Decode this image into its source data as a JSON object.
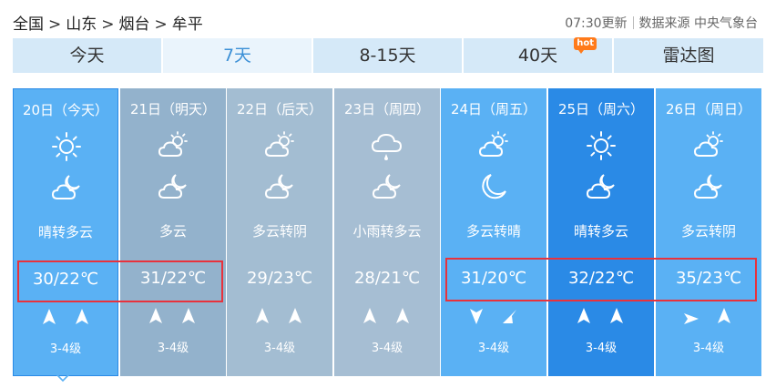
{
  "breadcrumb": [
    "全国",
    "山东",
    "烟台",
    "牟平"
  ],
  "breadcrumb_sep": ">",
  "update_time": "07:30更新",
  "data_source": "数据来源 中央气象台",
  "tabs": [
    {
      "label": "今天"
    },
    {
      "label": "7天",
      "active": true
    },
    {
      "label": "8-15天"
    },
    {
      "label": "40天",
      "badge": "hot"
    },
    {
      "label": "雷达图"
    }
  ],
  "days": [
    {
      "date": "20日（今天）",
      "icon_day": "sunny-icon",
      "icon_night": "cloudy-night-icon",
      "desc": "晴转多云",
      "temp": "30/22℃",
      "wind_dir": [
        "north-wind-icon",
        "north-wind-icon"
      ],
      "level": "3-4级",
      "bg": "#5ab1f4",
      "selected": true
    },
    {
      "date": "21日（明天）",
      "icon_day": "partly-cloudy-icon",
      "icon_night": "cloudy-night-icon",
      "desc": "多云",
      "temp": "31/22℃",
      "wind_dir": [
        "north-wind-icon",
        "north-wind-icon"
      ],
      "level": "3-4级",
      "bg": "#93b2cc"
    },
    {
      "date": "22日（后天）",
      "icon_day": "partly-cloudy-icon",
      "icon_night": "cloudy-night-icon",
      "desc": "多云转阴",
      "temp": "29/23℃",
      "wind_dir": [
        "north-wind-icon",
        "north-wind-icon"
      ],
      "level": "3-4级",
      "bg": "#a3bdd2"
    },
    {
      "date": "23日（周四）",
      "icon_day": "light-rain-icon",
      "icon_night": "cloudy-night-icon",
      "desc": "小雨转多云",
      "temp": "28/21℃",
      "wind_dir": [
        "north-wind-icon",
        "north-wind-icon"
      ],
      "level": "3-4级",
      "bg": "#a6bed3"
    },
    {
      "date": "24日（周五）",
      "icon_day": "partly-cloudy-icon",
      "icon_night": "clear-night-icon",
      "desc": "多云转晴",
      "temp": "31/20℃",
      "wind_dir": [
        "south-wind-icon",
        "southwest-wind-icon"
      ],
      "level": "3-4级",
      "bg": "#5ab1f4"
    },
    {
      "date": "25日（周六）",
      "icon_day": "sunny-icon",
      "icon_night": "cloudy-night-icon",
      "desc": "晴转多云",
      "temp": "32/22℃",
      "wind_dir": [
        "north-wind-icon",
        "north-wind-icon"
      ],
      "level": "3-4级",
      "bg": "#2a8ae6"
    },
    {
      "date": "26日（周日）",
      "icon_day": "partly-cloudy-icon",
      "icon_night": "cloudy-night-icon",
      "desc": "多云转阴",
      "temp": "35/23℃",
      "wind_dir": [
        "east-wind-icon",
        "north-wind-icon"
      ],
      "level": "3-4级",
      "bg": "#5ab1f4"
    }
  ],
  "highlight_color": "#e8323c"
}
